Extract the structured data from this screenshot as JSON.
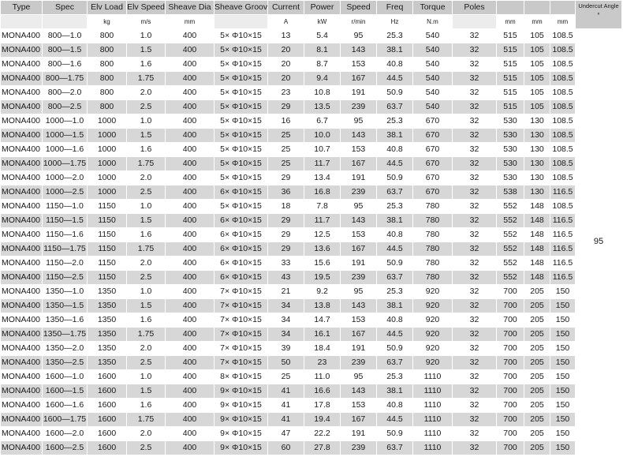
{
  "headers": [
    "Type",
    "Spec",
    "Elv Load",
    "Elv Speed",
    "Sheave Dia",
    "Sheave Groove",
    "Current",
    "Power",
    "Speed",
    "Freq",
    "Torque",
    "Poles",
    "",
    "",
    "",
    "Undercut Angle"
  ],
  "units": [
    "",
    "",
    "kg",
    "m/s",
    "mm",
    "",
    "A",
    "kW",
    "r/min",
    "Hz",
    "N.m",
    "",
    "mm",
    "mm",
    "mm",
    "°"
  ],
  "undercut_angle": "95",
  "rows": [
    [
      "MONA400",
      "800—1.0",
      "800",
      "1.0",
      "400",
      "5× Φ10×15",
      "13",
      "5.4",
      "95",
      "25.3",
      "540",
      "32",
      "515",
      "105",
      "108.5"
    ],
    [
      "MONA400",
      "800—1.5",
      "800",
      "1.5",
      "400",
      "5× Φ10×15",
      "20",
      "8.1",
      "143",
      "38.1",
      "540",
      "32",
      "515",
      "105",
      "108.5"
    ],
    [
      "MONA400",
      "800—1.6",
      "800",
      "1.6",
      "400",
      "5× Φ10×15",
      "20",
      "8.7",
      "153",
      "40.8",
      "540",
      "32",
      "515",
      "105",
      "108.5"
    ],
    [
      "MONA400",
      "800—1.75",
      "800",
      "1.75",
      "400",
      "5× Φ10×15",
      "20",
      "9.4",
      "167",
      "44.5",
      "540",
      "32",
      "515",
      "105",
      "108.5"
    ],
    [
      "MONA400",
      "800—2.0",
      "800",
      "2.0",
      "400",
      "5× Φ10×15",
      "23",
      "10.8",
      "191",
      "50.9",
      "540",
      "32",
      "515",
      "105",
      "108.5"
    ],
    [
      "MONA400",
      "800—2.5",
      "800",
      "2.5",
      "400",
      "5× Φ10×15",
      "29",
      "13.5",
      "239",
      "63.7",
      "540",
      "32",
      "515",
      "105",
      "108.5"
    ],
    [
      "MONA400",
      "1000—1.0",
      "1000",
      "1.0",
      "400",
      "5× Φ10×15",
      "16",
      "6.7",
      "95",
      "25.3",
      "670",
      "32",
      "530",
      "130",
      "108.5"
    ],
    [
      "MONA400",
      "1000—1.5",
      "1000",
      "1.5",
      "400",
      "5× Φ10×15",
      "25",
      "10.0",
      "143",
      "38.1",
      "670",
      "32",
      "530",
      "130",
      "108.5"
    ],
    [
      "MONA400",
      "1000—1.6",
      "1000",
      "1.6",
      "400",
      "5× Φ10×15",
      "25",
      "10.7",
      "153",
      "40.8",
      "670",
      "32",
      "530",
      "130",
      "108.5"
    ],
    [
      "MONA400",
      "1000—1.75",
      "1000",
      "1.75",
      "400",
      "5× Φ10×15",
      "25",
      "11.7",
      "167",
      "44.5",
      "670",
      "32",
      "530",
      "130",
      "108.5"
    ],
    [
      "MONA400",
      "1000—2.0",
      "1000",
      "2.0",
      "400",
      "5× Φ10×15",
      "29",
      "13.4",
      "191",
      "50.9",
      "670",
      "32",
      "530",
      "130",
      "108.5"
    ],
    [
      "MONA400",
      "1000—2.5",
      "1000",
      "2.5",
      "400",
      "6× Φ10×15",
      "36",
      "16.8",
      "239",
      "63.7",
      "670",
      "32",
      "538",
      "130",
      "116.5"
    ],
    [
      "MONA400",
      "1150—1.0",
      "1150",
      "1.0",
      "400",
      "5× Φ10×15",
      "18",
      "7.8",
      "95",
      "25.3",
      "780",
      "32",
      "552",
      "148",
      "108.5"
    ],
    [
      "MONA400",
      "1150—1.5",
      "1150",
      "1.5",
      "400",
      "6× Φ10×15",
      "29",
      "11.7",
      "143",
      "38.1",
      "780",
      "32",
      "552",
      "148",
      "116.5"
    ],
    [
      "MONA400",
      "1150—1.6",
      "1150",
      "1.6",
      "400",
      "6× Φ10×15",
      "29",
      "12.5",
      "153",
      "40.8",
      "780",
      "32",
      "552",
      "148",
      "116.5"
    ],
    [
      "MONA400",
      "1150—1.75",
      "1150",
      "1.75",
      "400",
      "6× Φ10×15",
      "29",
      "13.6",
      "167",
      "44.5",
      "780",
      "32",
      "552",
      "148",
      "116.5"
    ],
    [
      "MONA400",
      "1150—2.0",
      "1150",
      "2.0",
      "400",
      "6× Φ10×15",
      "33",
      "15.6",
      "191",
      "50.9",
      "780",
      "32",
      "552",
      "148",
      "116.5"
    ],
    [
      "MONA400",
      "1150—2.5",
      "1150",
      "2.5",
      "400",
      "6× Φ10×15",
      "43",
      "19.5",
      "239",
      "63.7",
      "780",
      "32",
      "552",
      "148",
      "116.5"
    ],
    [
      "MONA400",
      "1350—1.0",
      "1350",
      "1.0",
      "400",
      "7× Φ10×15",
      "21",
      "9.2",
      "95",
      "25.3",
      "920",
      "32",
      "700",
      "205",
      "150"
    ],
    [
      "MONA400",
      "1350—1.5",
      "1350",
      "1.5",
      "400",
      "7× Φ10×15",
      "34",
      "13.8",
      "143",
      "38.1",
      "920",
      "32",
      "700",
      "205",
      "150"
    ],
    [
      "MONA400",
      "1350—1.6",
      "1350",
      "1.6",
      "400",
      "7× Φ10×15",
      "34",
      "14.7",
      "153",
      "40.8",
      "920",
      "32",
      "700",
      "205",
      "150"
    ],
    [
      "MONA400",
      "1350—1.75",
      "1350",
      "1.75",
      "400",
      "7× Φ10×15",
      "34",
      "16.1",
      "167",
      "44.5",
      "920",
      "32",
      "700",
      "205",
      "150"
    ],
    [
      "MONA400",
      "1350—2.0",
      "1350",
      "2.0",
      "400",
      "7× Φ10×15",
      "39",
      "18.4",
      "191",
      "50.9",
      "920",
      "32",
      "700",
      "205",
      "150"
    ],
    [
      "MONA400",
      "1350—2.5",
      "1350",
      "2.5",
      "400",
      "7× Φ10×15",
      "50",
      "23",
      "239",
      "63.7",
      "920",
      "32",
      "700",
      "205",
      "150"
    ],
    [
      "MONA400",
      "1600—1.0",
      "1600",
      "1.0",
      "400",
      "8× Φ10×15",
      "25",
      "11.0",
      "95",
      "25.3",
      "1110",
      "32",
      "700",
      "205",
      "150"
    ],
    [
      "MONA400",
      "1600—1.5",
      "1600",
      "1.5",
      "400",
      "9× Φ10×15",
      "41",
      "16.6",
      "143",
      "38.1",
      "1110",
      "32",
      "700",
      "205",
      "150"
    ],
    [
      "MONA400",
      "1600—1.6",
      "1600",
      "1.6",
      "400",
      "9× Φ10×15",
      "41",
      "17.8",
      "153",
      "40.8",
      "1110",
      "32",
      "700",
      "205",
      "150"
    ],
    [
      "MONA400",
      "1600—1.75",
      "1600",
      "1.75",
      "400",
      "9× Φ10×15",
      "41",
      "19.4",
      "167",
      "44.5",
      "1110",
      "32",
      "700",
      "205",
      "150"
    ],
    [
      "MONA400",
      "1600—2.0",
      "1600",
      "2.0",
      "400",
      "9× Φ10×15",
      "47",
      "22.2",
      "191",
      "50.9",
      "1110",
      "32",
      "700",
      "205",
      "150"
    ],
    [
      "MONA400",
      "1600—2.5",
      "1600",
      "2.5",
      "400",
      "9× Φ10×15",
      "60",
      "27.8",
      "239",
      "63.7",
      "1110",
      "32",
      "700",
      "205",
      "150"
    ]
  ]
}
